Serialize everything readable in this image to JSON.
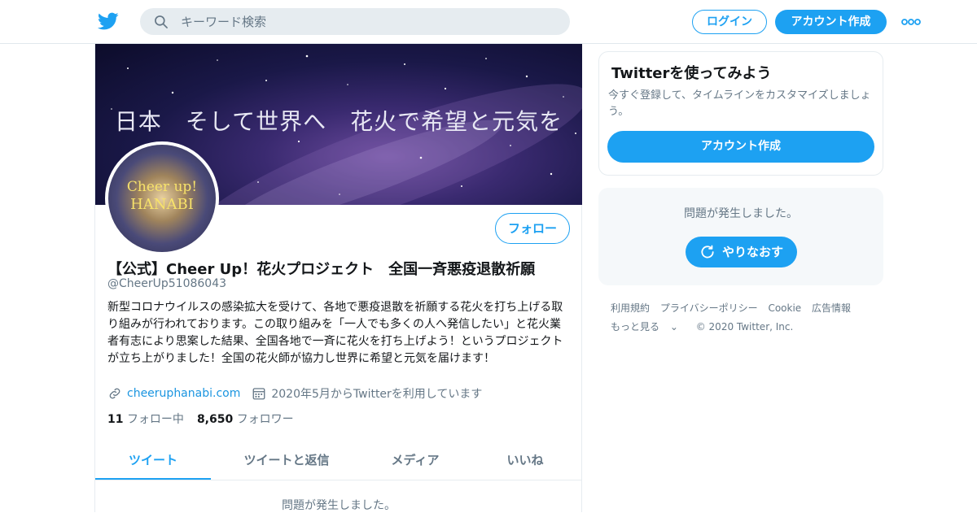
{
  "nav": {
    "search_placeholder": "キーワード検索",
    "login_label": "ログイン",
    "signup_label": "アカウント作成"
  },
  "profile": {
    "banner_text": "日本　そして世界へ　花火で希望と元気を",
    "avatar_line1": "Cheer up!",
    "avatar_line2": "HANABI",
    "follow_label": "フォロー",
    "name": "【公式】Cheer Up！花火プロジェクト　全国一斉悪疫退散祈願",
    "handle": "@CheerUp51086043",
    "bio": "新型コロナウイルスの感染拡大を受けて、各地で悪疫退散を祈願する花火を打ち上げる取り組みが行われております。この取り組みを「一人でも多くの人へ発信したい」と花火業者有志により思案した結果、全国各地で一斉に花火を打ち上げよう！というプロジェクトが立ち上がりました！全国の花火師が協力し世界に希望と元気を届けます！",
    "website": "cheeruphanabi.com",
    "joined": "2020年5月からTwitterを利用しています",
    "following_count": "11",
    "following_label": "フォロー中",
    "followers_count": "8,650",
    "followers_label": "フォロワー"
  },
  "tabs": [
    {
      "label": "ツイート",
      "active": true
    },
    {
      "label": "ツイートと返信",
      "active": false
    },
    {
      "label": "メディア",
      "active": false
    },
    {
      "label": "いいね",
      "active": false
    }
  ],
  "main_error": "問題が発生しました。",
  "sidebar": {
    "signup_title": "Twitterを使ってみよう",
    "signup_sub": "今すぐ登録して、タイムラインをカスタマイズしましょう。",
    "signup_button": "アカウント作成",
    "error_msg": "問題が発生しました。",
    "retry_label": "やりなおす"
  },
  "footer": {
    "links": [
      "利用規約",
      "プライバシーポリシー",
      "Cookie",
      "広告情報"
    ],
    "more": "もっと見る",
    "copyright": "© 2020 Twitter, Inc."
  },
  "colors": {
    "accent": "#1da1f2",
    "muted_text": "#657786",
    "border": "#e6ecf0"
  }
}
